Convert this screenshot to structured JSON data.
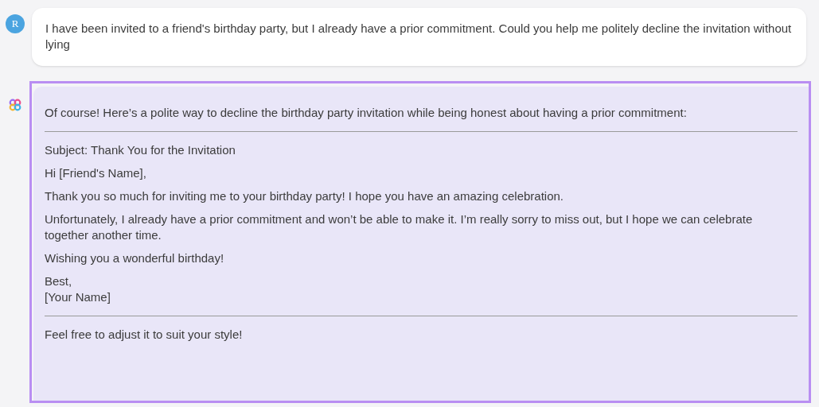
{
  "user_message": {
    "avatar": "R",
    "text": "I have been invited to a friend's birthday party, but I already have a prior commitment. Could you help me politely decline the invitation without lying"
  },
  "response": {
    "selected": true,
    "blocks": [
      {
        "kind": "paragraph",
        "text": "Of course! Here’s a polite way to decline the birthday party invitation while being honest about having a prior commitment:"
      },
      {
        "kind": "rule"
      },
      {
        "kind": "paragraph",
        "text": "Subject: Thank You for the Invitation"
      },
      {
        "kind": "paragraph",
        "text": "Hi [Friend's Name],"
      },
      {
        "kind": "paragraph",
        "text": "Thank you so much for inviting me to your birthday party! I hope you have an amazing celebration."
      },
      {
        "kind": "paragraph",
        "text": "Unfortunately, I already have a prior commitment and won’t be able to make it. I’m really sorry to miss out, but I hope we can celebrate together another time."
      },
      {
        "kind": "paragraph",
        "text": "Wishing you a wonderful birthday!"
      },
      {
        "kind": "lines",
        "lines": [
          "Best,",
          "[Your Name]"
        ]
      },
      {
        "kind": "rule"
      },
      {
        "kind": "paragraph",
        "text": "Feel free to adjust it to suit your style!"
      }
    ]
  }
}
